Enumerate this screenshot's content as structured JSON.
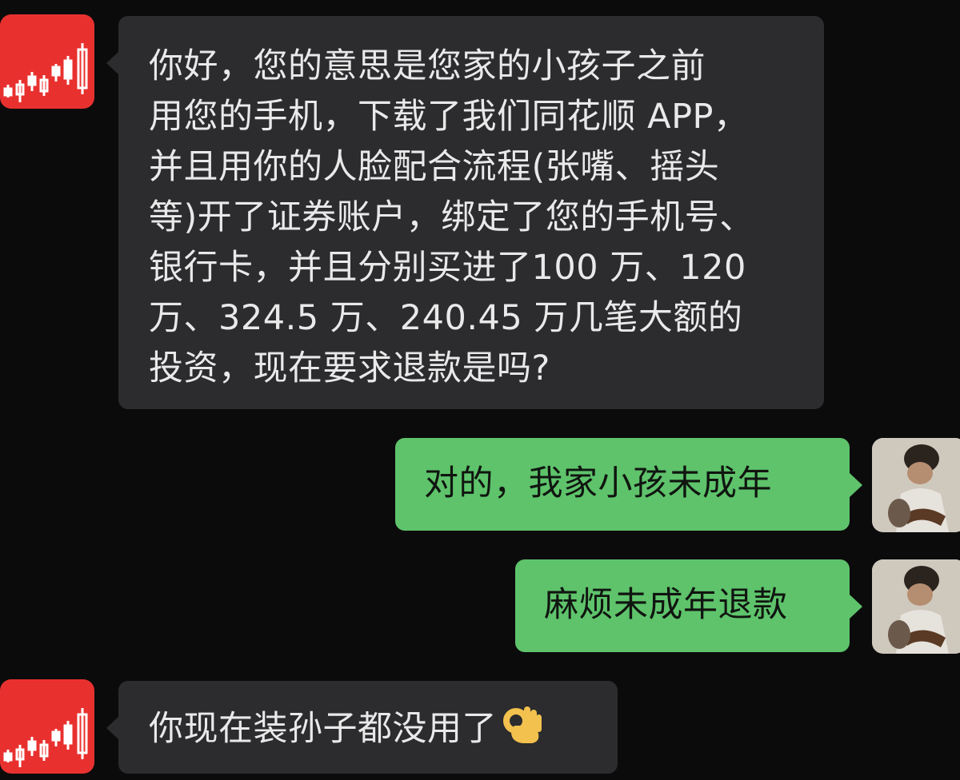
{
  "conversation": {
    "messages": [
      {
        "sender": "同花顺",
        "lines": [
          "你好，您的意思是您家的小孩子之前",
          "用您的手机，下载了我们同花顺 APP，",
          "并且用你的人脸配合流程(张嘴、摇头",
          "等)开了证券账户，绑定了您的手机号、",
          "银行卡，并且分别买进了100 万、120",
          "万、324.5 万、240.45 万几笔大额的",
          "投资，现在要求退款是吗?"
        ]
      },
      {
        "sender": "user",
        "text": "对的，我家小孩未成年"
      },
      {
        "sender": "user",
        "text": "麻烦未成年退款"
      },
      {
        "sender": "同花顺",
        "text": "你现在装孙子都没用了",
        "emoji": "ok-hand"
      }
    ]
  },
  "colors": {
    "background": "#0b0b0c",
    "incoming_bubble": "#2c2c2e",
    "outgoing_bubble": "#5ec36b",
    "brand_avatar": "#e8312f"
  }
}
